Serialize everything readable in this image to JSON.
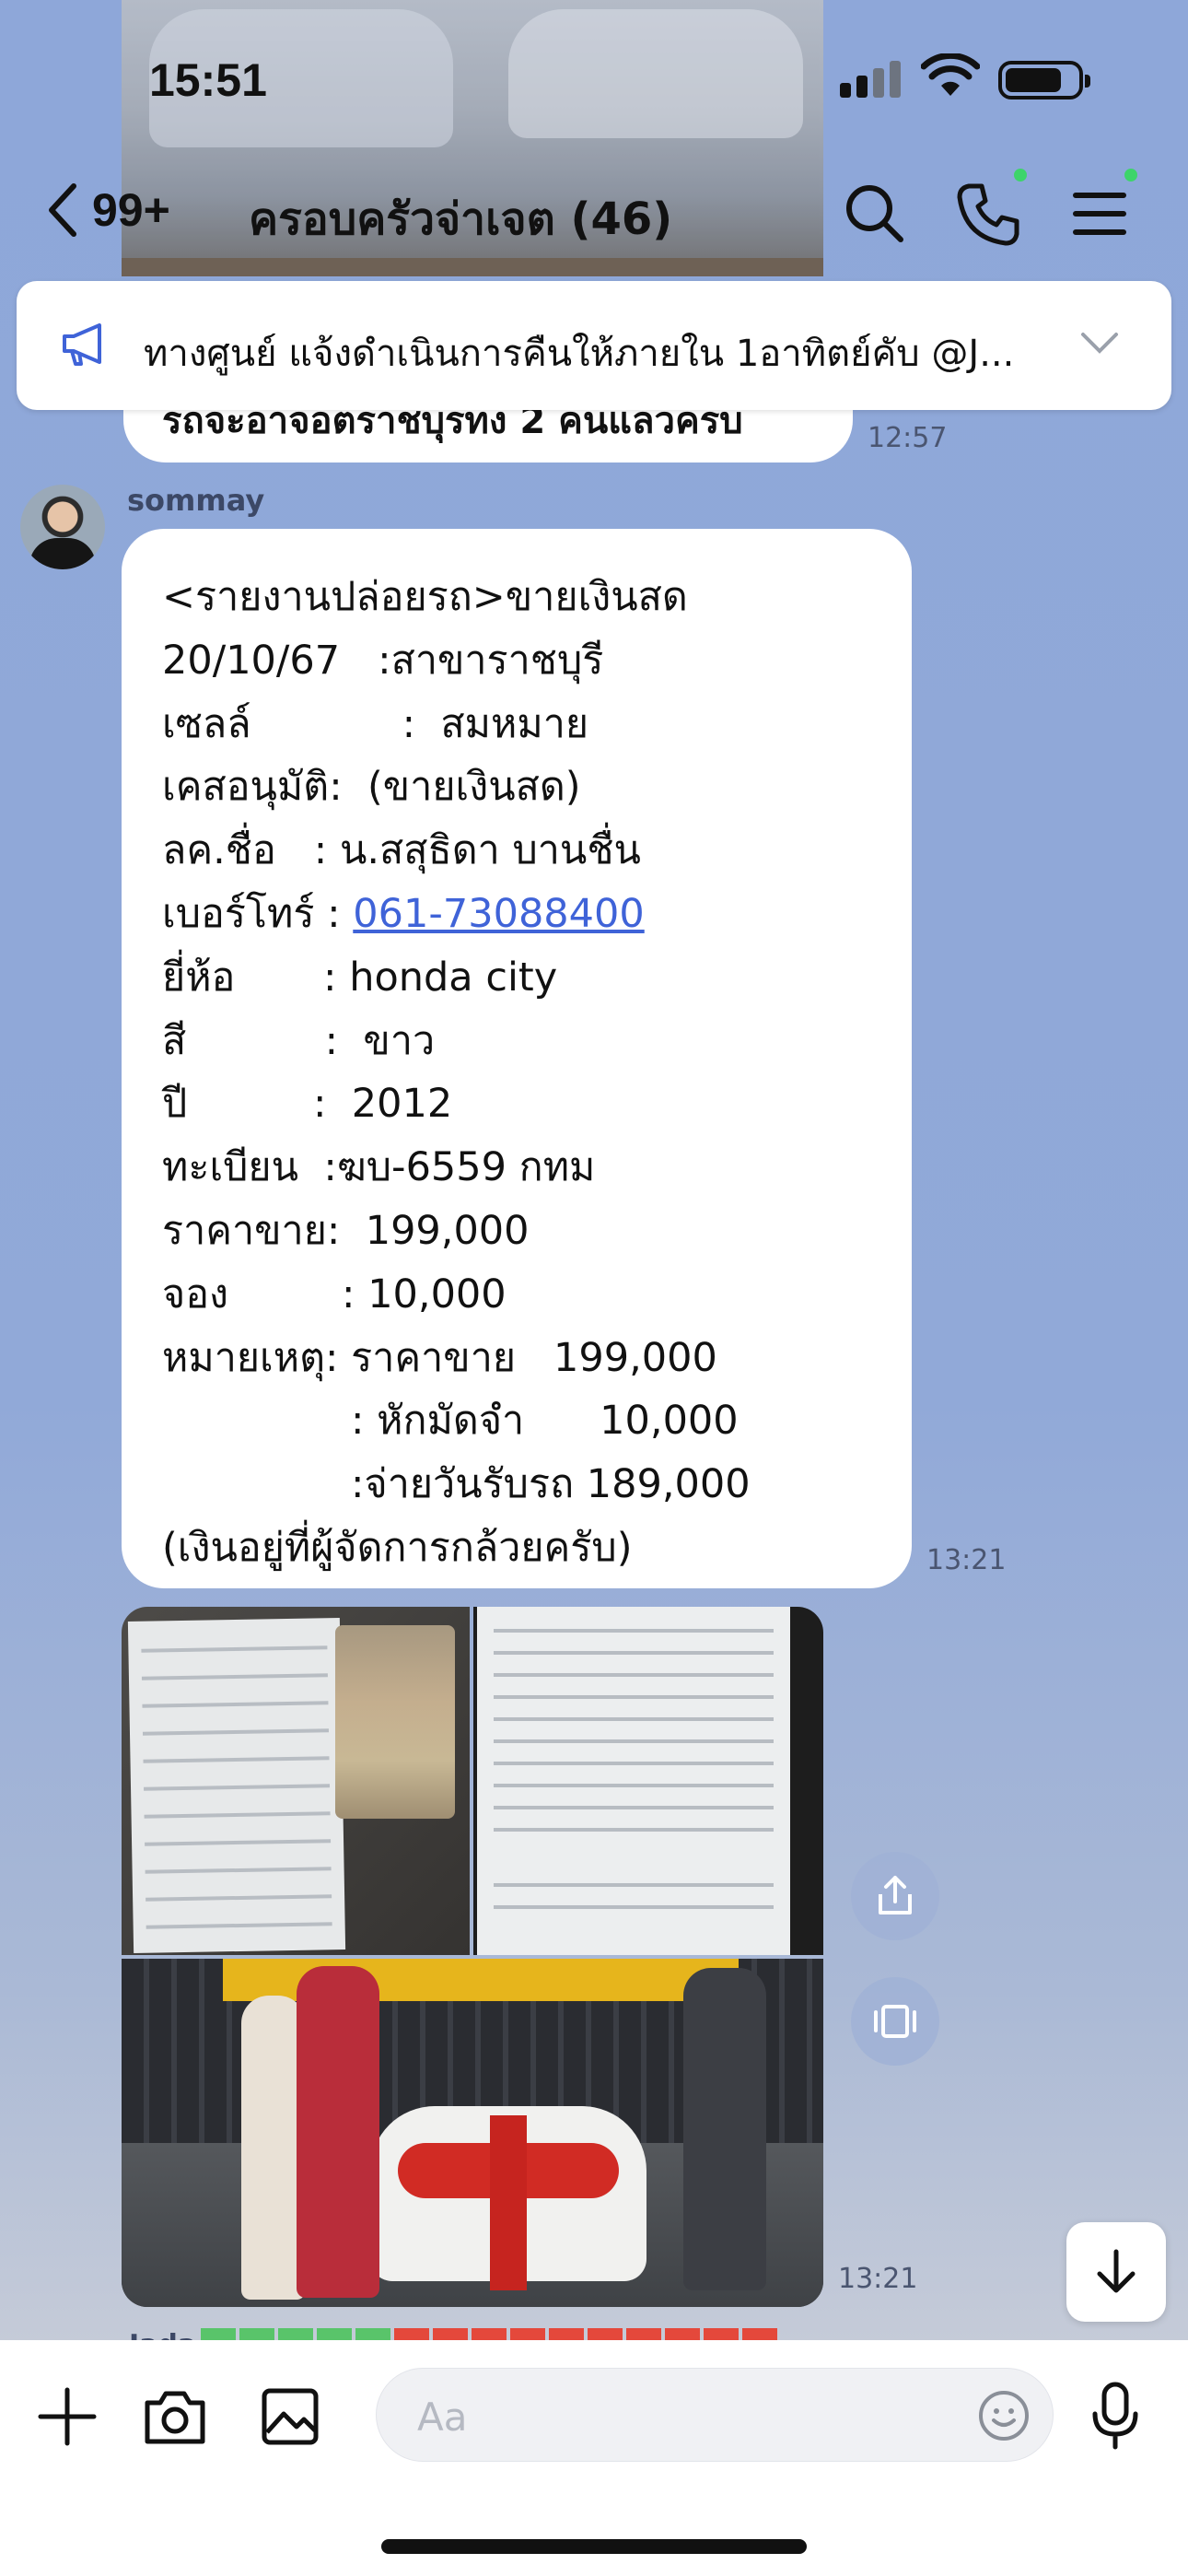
{
  "status_bar": {
    "time": "15:51"
  },
  "header": {
    "back_count": "99+",
    "title": "ครอบครัวจ่าเจต (46)"
  },
  "announcement": {
    "text": "ทางศูนย์ แจ้งดำเนินการคืนให้ภายใน 1อาทิตย์คับ @J..."
  },
  "previous_message": {
    "text": "รถจะอาจอตราชบุรทง 2 คนแลวครบ",
    "time": "12:57"
  },
  "message": {
    "sender": "sommay",
    "time": "13:21",
    "lines": [
      "<รายงานปล่อยรถ>ขายเงินสด",
      "20/10/67   :สาขาราชบุรี",
      "เซลล์            :  สมหมาย",
      "เคสอนุมัติ:  (ขายเงินสด)",
      "ลค.ชื่อ   : น.สสุธิดา บานชื่น",
      "เบอร์โทร์ : ",
      "ยี่ห้อ       : honda city",
      "สี           :  ขาว",
      "ปี          :  2012",
      "ทะเบียน  :ฆบ-6559 กทม",
      "ราคาขาย:  199,000",
      "จอง         : 10,000",
      "หมายเหตุ: ราคาขาย   199,000",
      "               : หักมัดจำ      10,000",
      "               :จ่ายวันรับรถ 189,000",
      "(เงินอยู่ที่ผู้จัดการกล้วยครับ)"
    ],
    "phone": "061-73088400"
  },
  "image_message": {
    "time": "13:21",
    "images": [
      "receipt-with-cash-photo",
      "contract-document-photo",
      "car-delivery-photo"
    ]
  },
  "next_message": {
    "sender": "Jada"
  },
  "composer": {
    "placeholder": "Aa"
  },
  "colors": {
    "background": "#8fa8d8",
    "bubble": "#ffffff",
    "link": "#3f63d8",
    "online_dot": "#3dd46a"
  }
}
